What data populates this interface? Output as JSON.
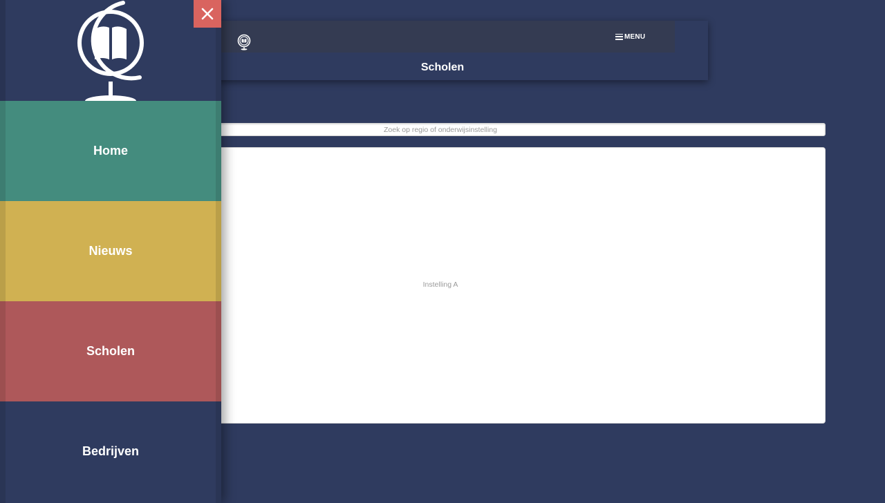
{
  "header": {
    "menu_label": "MENU",
    "page_title": "Scholen"
  },
  "search": {
    "placeholder": "Zoek op regio of onderwijsinstelling",
    "value": ""
  },
  "results": {
    "items": [
      "Instelling A"
    ]
  },
  "drawer": {
    "close_icon": "close-icon",
    "logo_icon": "globe-book-icon",
    "items": [
      {
        "label": "Home",
        "color": "#448c7e"
      },
      {
        "label": "Nieuws",
        "color": "#d0b152"
      },
      {
        "label": "Scholen",
        "color": "#ae585a"
      },
      {
        "label": "Bedrijven",
        "color": "#2f3b5f"
      }
    ]
  },
  "colors": {
    "background": "#2f3b5f",
    "topbar": "#343b52",
    "close_button": "#d9645f"
  }
}
